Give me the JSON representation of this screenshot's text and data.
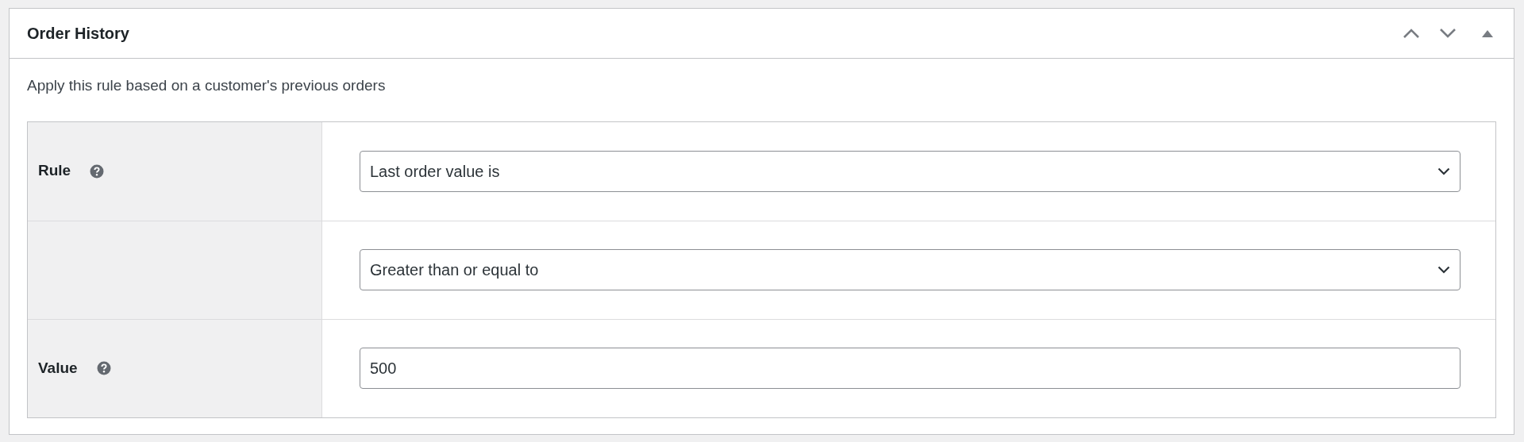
{
  "panel": {
    "title": "Order History",
    "description": "Apply this rule based on a customer's previous orders"
  },
  "rows": [
    {
      "label": "Rule",
      "help": true,
      "kind": "select",
      "value": "Last order value is"
    },
    {
      "help": false,
      "kind": "select",
      "value": "Greater than or equal to"
    },
    {
      "label": "Value",
      "help": true,
      "kind": "input",
      "value": "500"
    }
  ]
}
